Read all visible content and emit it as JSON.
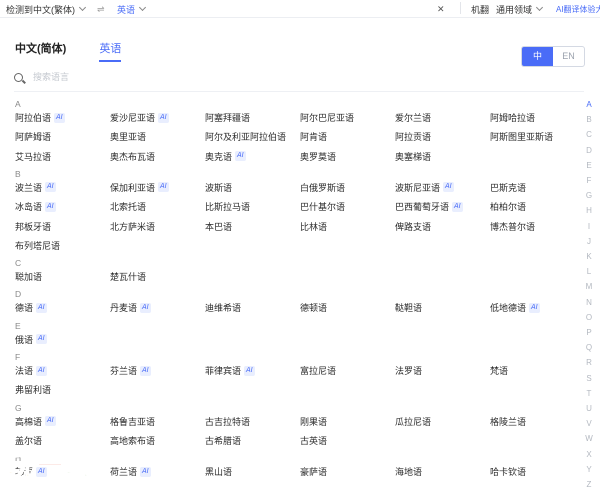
{
  "top_bar": {
    "source_label": "检测到中文(繁体)",
    "swap_symbol": "⇌",
    "target_label": "英语",
    "close_symbol": "✕",
    "machine_label": "机翻",
    "domain_label": "通用领域",
    "ai_label": "AI翻译体验大"
  },
  "tabs": [
    "中文(简体)",
    "英语"
  ],
  "toggle": [
    "中",
    "EN"
  ],
  "search": {
    "placeholder": "搜索语言"
  },
  "sections": [
    {
      "letter": "A",
      "rows": [
        [
          {
            "t": "阿拉伯语",
            "ai": true
          },
          {
            "t": "爱沙尼亚语",
            "ai": true
          },
          {
            "t": "阿塞拜疆语"
          },
          {
            "t": "阿尔巴尼亚语"
          },
          {
            "t": "爱尔兰语"
          },
          {
            "t": "阿姆哈拉语"
          }
        ],
        [
          {
            "t": "阿萨姆语"
          },
          {
            "t": "奥里亚语"
          },
          {
            "t": "阿尔及利亚阿拉伯语"
          },
          {
            "t": "阿肯语"
          },
          {
            "t": "阿拉贡语"
          },
          {
            "t": "阿斯图里亚斯语"
          }
        ],
        [
          {
            "t": "艾马拉语"
          },
          {
            "t": "奥杰布瓦语"
          },
          {
            "t": "奥克语",
            "ai": true
          },
          {
            "t": "奥罗莫语"
          },
          {
            "t": "奥塞梯语"
          }
        ]
      ]
    },
    {
      "letter": "B",
      "rows": [
        [
          {
            "t": "波兰语",
            "ai": true
          },
          {
            "t": "保加利亚语",
            "ai": true
          },
          {
            "t": "波斯语"
          },
          {
            "t": "白俄罗斯语"
          },
          {
            "t": "波斯尼亚语",
            "ai": true
          },
          {
            "t": "巴斯克语"
          }
        ],
        [
          {
            "t": "冰岛语",
            "ai": true
          },
          {
            "t": "北索托语"
          },
          {
            "t": "比斯拉马语"
          },
          {
            "t": "巴什基尔语"
          },
          {
            "t": "巴西葡萄牙语",
            "ai": true
          },
          {
            "t": "柏柏尔语"
          }
        ],
        [
          {
            "t": "邦板牙语"
          },
          {
            "t": "北方萨米语"
          },
          {
            "t": "本巴语"
          },
          {
            "t": "比林语"
          },
          {
            "t": "俾路支语"
          },
          {
            "t": "博杰普尔语"
          }
        ],
        [
          {
            "t": "布列塔尼语"
          }
        ]
      ]
    },
    {
      "letter": "C",
      "rows": [
        [
          {
            "t": "聪加语"
          },
          {
            "t": "楚瓦什语"
          }
        ]
      ]
    },
    {
      "letter": "D",
      "rows": [
        [
          {
            "t": "德语",
            "ai": true
          },
          {
            "t": "丹麦语",
            "ai": true
          },
          {
            "t": "迪维希语"
          },
          {
            "t": "德顿语"
          },
          {
            "t": "鞑靼语"
          },
          {
            "t": "低地德语",
            "ai": true
          }
        ]
      ]
    },
    {
      "letter": "E",
      "rows": [
        [
          {
            "t": "俄语",
            "ai": true
          }
        ]
      ]
    },
    {
      "letter": "F",
      "rows": [
        [
          {
            "t": "法语",
            "ai": true
          },
          {
            "t": "芬兰语",
            "ai": true
          },
          {
            "t": "菲律宾语",
            "ai": true
          },
          {
            "t": "富拉尼语"
          },
          {
            "t": "法罗语"
          },
          {
            "t": "梵语"
          }
        ],
        [
          {
            "t": "弗留利语"
          }
        ]
      ]
    },
    {
      "letter": "G",
      "rows": [
        [
          {
            "t": "高棉语",
            "ai": true
          },
          {
            "t": "格鲁吉亚语"
          },
          {
            "t": "古吉拉特语"
          },
          {
            "t": "刚果语"
          },
          {
            "t": "瓜拉尼语"
          },
          {
            "t": "格陵兰语"
          }
        ],
        [
          {
            "t": "盖尔语"
          },
          {
            "t": "高地索布语"
          },
          {
            "t": "古希腊语"
          },
          {
            "t": "古英语"
          }
        ]
      ]
    },
    {
      "letter": "H",
      "rows": [
        [
          {
            "t": "韩语",
            "ai": true
          },
          {
            "t": "荷兰语",
            "ai": true
          },
          {
            "t": "黑山语"
          },
          {
            "t": "豪萨语"
          },
          {
            "t": "海地语"
          },
          {
            "t": "哈卡钦语"
          }
        ]
      ]
    }
  ],
  "index": [
    "A",
    "B",
    "C",
    "D",
    "E",
    "F",
    "G",
    "H",
    "I",
    "J",
    "K",
    "L",
    "M",
    "N",
    "O",
    "P",
    "Q",
    "R",
    "S",
    "T",
    "U",
    "V",
    "W",
    "X",
    "Y",
    "Z"
  ],
  "watermark": [
    "玩",
    "一",
    "玩"
  ],
  "colors": {
    "accent": "#4a6cf7",
    "ai_badge_bg": "#e9eefe",
    "text": "#2b2b2b",
    "muted": "#888888"
  }
}
